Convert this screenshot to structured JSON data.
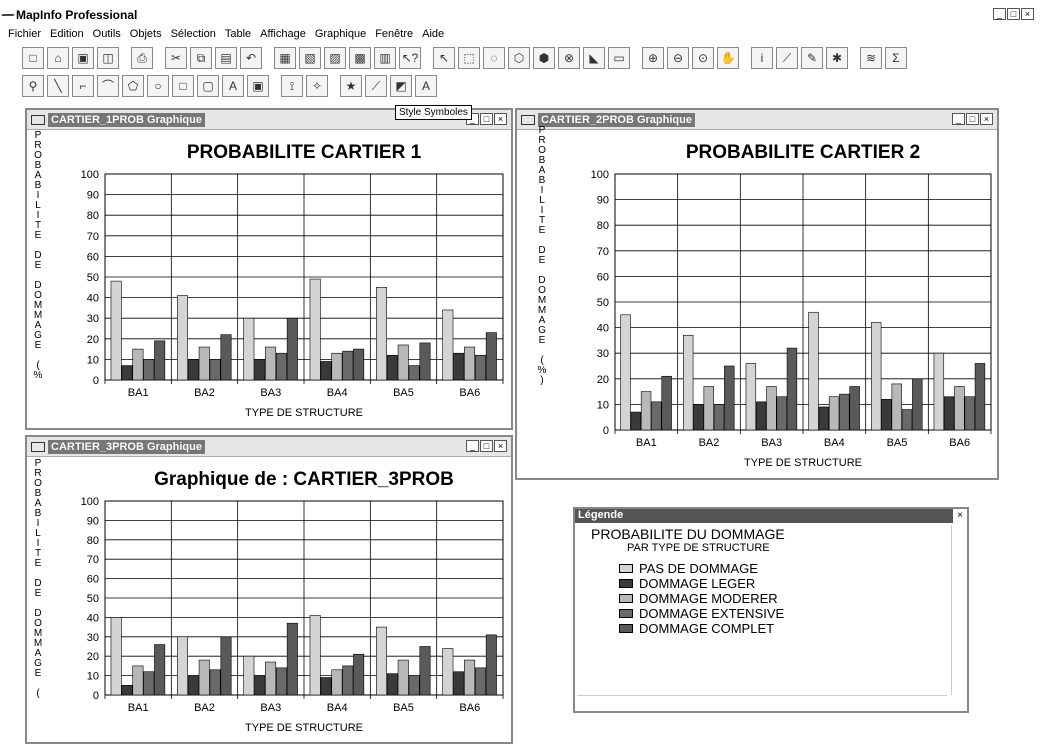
{
  "app": {
    "title": "MapInfo Professional"
  },
  "menu": [
    "Fichier",
    "Edition",
    "Outils",
    "Objets",
    "Sélection",
    "Table",
    "Affichage",
    "Graphique",
    "Fenêtre",
    "Aide"
  ],
  "tooltip": "Style Symboles",
  "windows": [
    {
      "title": "CARTIER_1PROB Graphique",
      "vlabel": "PROBABILITE DE DOMMAGE (%"
    },
    {
      "title": "CARTIER_2PROB Graphique",
      "vlabel": "PROBABILITE DE DOMMAGE (%)"
    },
    {
      "title": "CARTIER_3PROB Graphique",
      "vlabel": "PROBABILITE DE DOMMAGE ("
    }
  ],
  "legend": {
    "window_title": "Légende",
    "title": "PROBABILITE DU DOMMAGE",
    "subtitle": "PAR TYPE DE STRUCTURE",
    "items": [
      "PAS DE DOMMAGE",
      "DOMMAGE LEGER",
      "DOMMAGE MODERER",
      "DOMMAGE EXTENSIVE",
      "DOMMAGE COMPLET"
    ]
  },
  "colors": {
    "pas": "#d4d4d4",
    "leger": "#3a3a3a",
    "moderer": "#b8b8b8",
    "extensive": "#6a6a6a",
    "complet": "#5a5a5a"
  },
  "chart_data": [
    {
      "type": "bar",
      "title": "PROBABILITE CARTIER 1",
      "xlabel": "TYPE DE STRUCTURE",
      "ylabel": "PROBABILITE DE DOMMAGE (%",
      "ylim": [
        0,
        100
      ],
      "grid": true,
      "categories": [
        "BA1",
        "BA2",
        "BA3",
        "BA4",
        "BA5",
        "BA6"
      ],
      "series": [
        {
          "name": "PAS DE DOMMAGE",
          "values": [
            48,
            41,
            30,
            49,
            45,
            34
          ]
        },
        {
          "name": "DOMMAGE LEGER",
          "values": [
            7,
            10,
            10,
            9,
            12,
            13
          ]
        },
        {
          "name": "DOMMAGE MODERER",
          "values": [
            15,
            16,
            16,
            13,
            17,
            16
          ]
        },
        {
          "name": "DOMMAGE EXTENSIVE",
          "values": [
            10,
            10,
            13,
            14,
            7,
            12
          ]
        },
        {
          "name": "DOMMAGE COMPLET",
          "values": [
            19,
            22,
            30,
            15,
            18,
            23
          ]
        }
      ]
    },
    {
      "type": "bar",
      "title": "PROBABILITE CARTIER 2",
      "xlabel": "TYPE DE STRUCTURE",
      "ylabel": "PROBABILITE DE DOMMAGE (%)",
      "ylim": [
        0,
        100
      ],
      "grid": true,
      "categories": [
        "BA1",
        "BA2",
        "BA3",
        "BA4",
        "BA5",
        "BA6"
      ],
      "series": [
        {
          "name": "PAS DE DOMMAGE",
          "values": [
            45,
            37,
            26,
            46,
            42,
            30
          ]
        },
        {
          "name": "DOMMAGE LEGER",
          "values": [
            7,
            10,
            11,
            9,
            12,
            13
          ]
        },
        {
          "name": "DOMMAGE MODERER",
          "values": [
            15,
            17,
            17,
            13,
            18,
            17
          ]
        },
        {
          "name": "DOMMAGE EXTENSIVE",
          "values": [
            11,
            10,
            13,
            14,
            8,
            13
          ]
        },
        {
          "name": "DOMMAGE COMPLET",
          "values": [
            21,
            25,
            32,
            17,
            20,
            26
          ]
        }
      ]
    },
    {
      "type": "bar",
      "title": "Graphique de : CARTIER_3PROB",
      "xlabel": "TYPE DE STRUCTURE",
      "ylabel": "PROBABILITE DE DOMMAGE (",
      "ylim": [
        0,
        100
      ],
      "grid": true,
      "categories": [
        "BA1",
        "BA2",
        "BA3",
        "BA4",
        "BA5",
        "BA6"
      ],
      "series": [
        {
          "name": "PAS DE DOMMAGE",
          "values": [
            40,
            30,
            20,
            41,
            35,
            24
          ]
        },
        {
          "name": "DOMMAGE LEGER",
          "values": [
            5,
            10,
            10,
            9,
            11,
            12
          ]
        },
        {
          "name": "DOMMAGE MODERER",
          "values": [
            15,
            18,
            17,
            13,
            18,
            18
          ]
        },
        {
          "name": "DOMMAGE EXTENSIVE",
          "values": [
            12,
            13,
            14,
            15,
            10,
            14
          ]
        },
        {
          "name": "DOMMAGE COMPLET",
          "values": [
            26,
            30,
            37,
            21,
            25,
            31
          ]
        }
      ]
    }
  ]
}
